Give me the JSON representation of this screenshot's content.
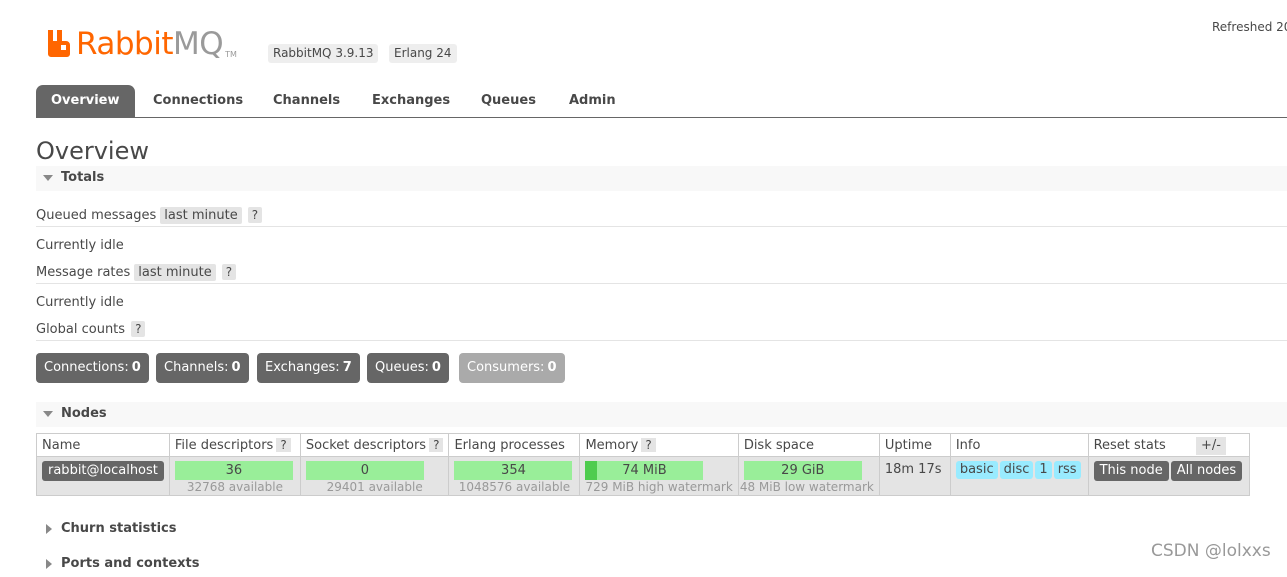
{
  "header": {
    "logo_rabbit": "Rabbit",
    "logo_mq": "MQ",
    "logo_tm": "TM",
    "version": "RabbitMQ 3.9.13",
    "erlang": "Erlang 24",
    "refreshed": "Refreshed 20"
  },
  "tabs": [
    "Overview",
    "Connections",
    "Channels",
    "Exchanges",
    "Queues",
    "Admin"
  ],
  "page_title": "Overview",
  "totals": {
    "heading": "Totals",
    "queued_label": "Queued messages",
    "queued_period": "last minute",
    "help": "?",
    "queued_status": "Currently idle",
    "rates_label": "Message rates",
    "rates_period": "last minute",
    "rates_status": "Currently idle",
    "global_label": "Global counts"
  },
  "counts": [
    {
      "label": "Connections:",
      "value": "0"
    },
    {
      "label": "Channels:",
      "value": "0"
    },
    {
      "label": "Exchanges:",
      "value": "7"
    },
    {
      "label": "Queues:",
      "value": "0"
    },
    {
      "label": "Consumers:",
      "value": "0"
    }
  ],
  "nodes": {
    "heading": "Nodes",
    "columns": [
      "Name",
      "File descriptors",
      "Socket descriptors",
      "Erlang processes",
      "Memory",
      "Disk space",
      "Uptime",
      "Info",
      "Reset stats"
    ],
    "plus_minus": "+/-",
    "row": {
      "name": "rabbit@localhost",
      "file_desc": "36",
      "file_avail": "32768 available",
      "socket_desc": "0",
      "socket_avail": "29401 available",
      "erlang_proc": "354",
      "erlang_avail": "1048576 available",
      "memory": "74 MiB",
      "memory_fraction": 0.1,
      "memory_watermark": "729 MiB high watermark",
      "disk": "29 GiB",
      "disk_watermark": "48 MiB low watermark",
      "uptime": "18m 17s",
      "info_tags": [
        "basic",
        "disc",
        "1",
        "rss"
      ],
      "reset_this": "This node",
      "reset_all": "All nodes"
    }
  },
  "collapsed_sections": [
    "Churn statistics",
    "Ports and contexts"
  ],
  "watermark": "CSDN @lolxxs",
  "colors": {
    "brand": "#ff6600",
    "tab_active": "#666666",
    "bar_green": "#99ee99",
    "info_blue": "#99ebff"
  }
}
